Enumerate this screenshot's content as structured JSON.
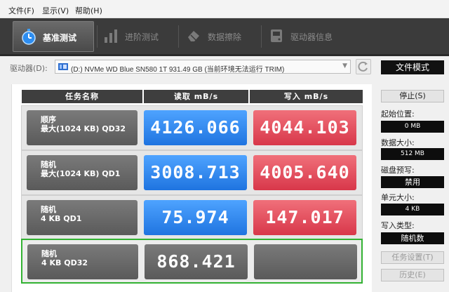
{
  "menu": [
    "文件(F)",
    "显示(V)",
    "帮助(H)"
  ],
  "tabs": [
    {
      "label": "基准测试",
      "icon": "stopwatch-icon"
    },
    {
      "label": "进阶测试",
      "icon": "bar-chart-icon"
    },
    {
      "label": "数据擦除",
      "icon": "eraser-icon"
    },
    {
      "label": "驱动器信息",
      "icon": "drive-info-icon"
    }
  ],
  "drive": {
    "label": "驱动器(D):",
    "selected": "(D:) NVMe WD Blue SN580 1T  931.49 GB (当前环境无法运行 TRIM)",
    "mode_button": "文件模式"
  },
  "table": {
    "headers": [
      "任务名称",
      "读取 mB/s",
      "写入 mB/s"
    ],
    "rows": [
      {
        "line1": "顺序",
        "line2": "最大(1024 KB) QD32",
        "read": "4126.066",
        "write": "4044.103"
      },
      {
        "line1": "随机",
        "line2": "最大(1024 KB) QD1",
        "read": "3008.713",
        "write": "4005.640"
      },
      {
        "line1": "随机",
        "line2": "4 KB QD1",
        "read": "75.974",
        "write": "147.017"
      },
      {
        "line1": "随机",
        "line2": "4 KB QD32",
        "read": "868.421",
        "write": ""
      }
    ]
  },
  "side": {
    "stop_button": "停止(S)",
    "start_pos_label": "起始位置:",
    "start_pos_value": "0 MB",
    "data_size_label": "数据大小:",
    "data_size_value": "512 MB",
    "precondition_label": "磁盘预写:",
    "precondition_value": "禁用",
    "unit_size_label": "单元大小:",
    "unit_size_value": "4 KB",
    "write_type_label": "写入类型:",
    "write_type_value": "随机数",
    "task_settings_button": "任务设置(T)",
    "history_button": "历史(E)"
  },
  "colors": {
    "read": "#2f86f0",
    "write": "#e2505e",
    "active_border": "#33b233",
    "toolbar": "#3b3b3b"
  }
}
